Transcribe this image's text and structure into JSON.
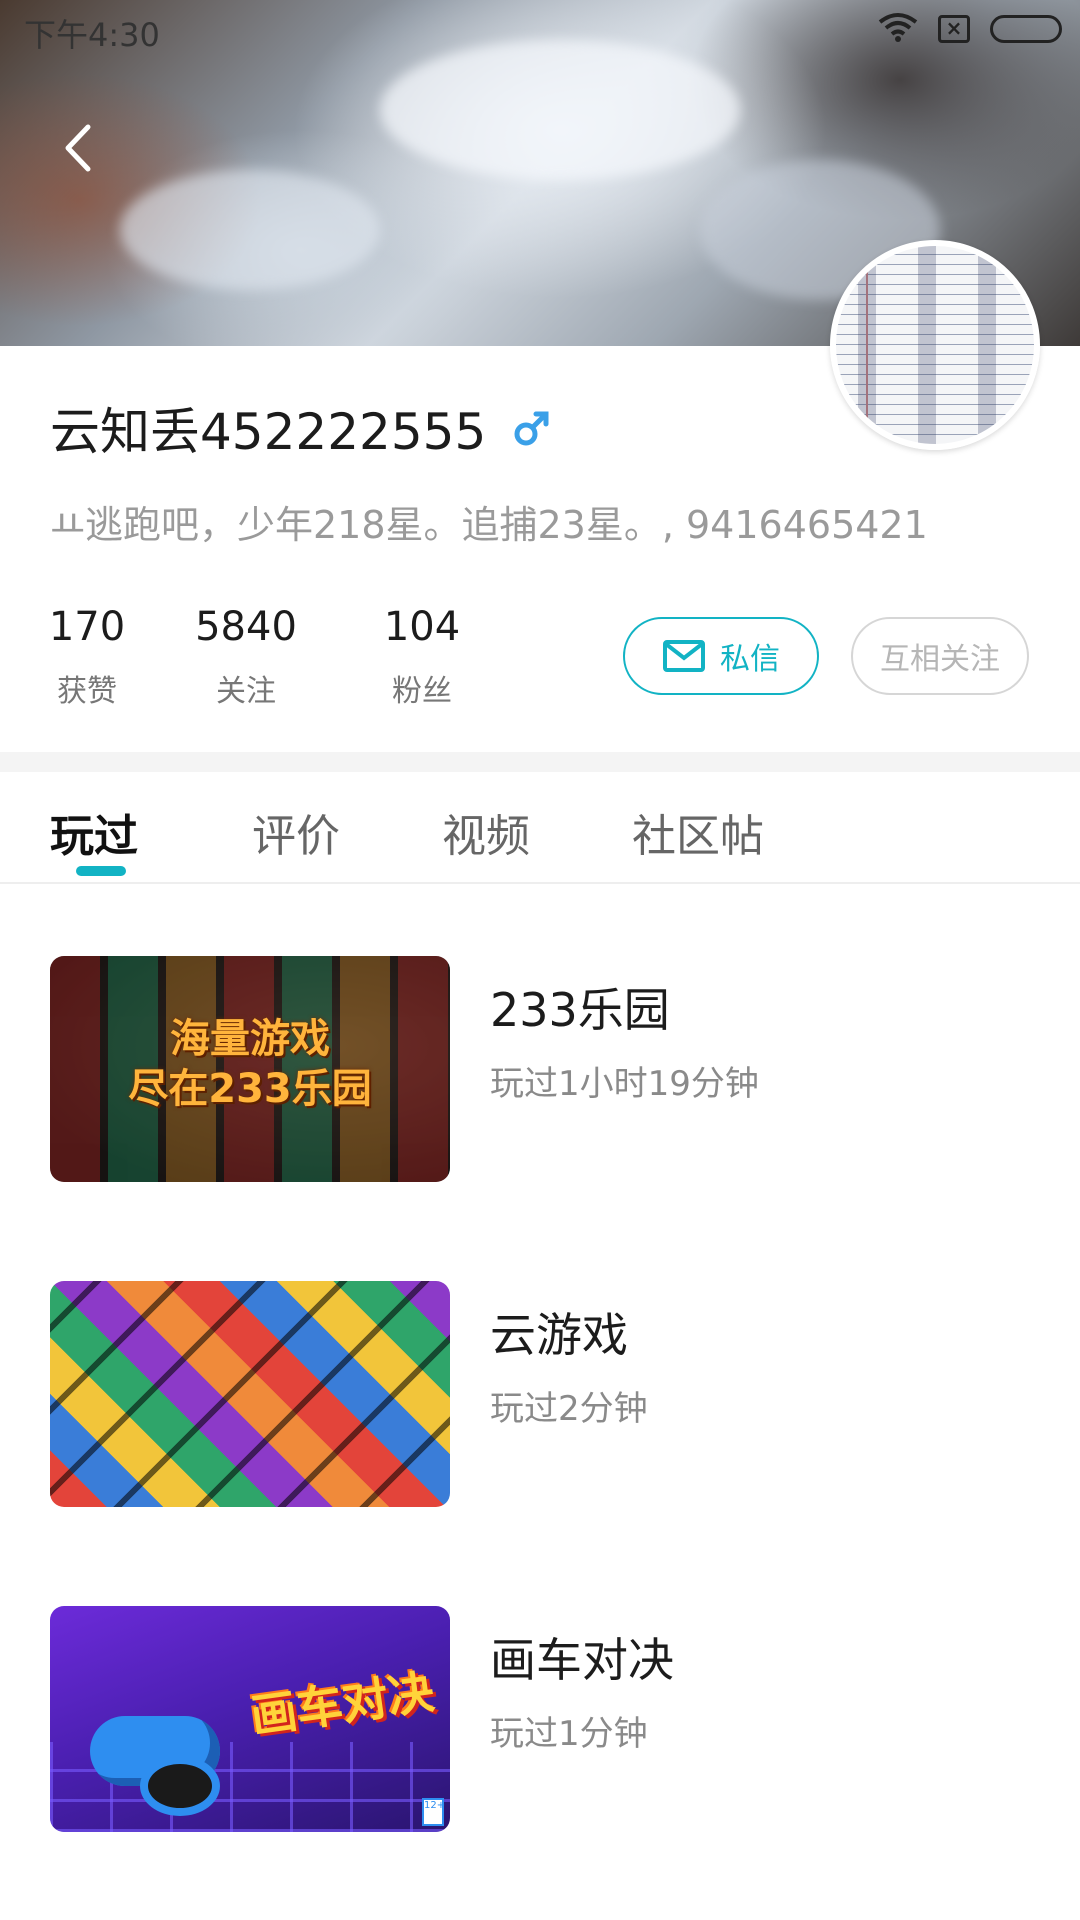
{
  "status_bar": {
    "time": "下午4:30"
  },
  "profile": {
    "username": "云知丢452222555",
    "signature": "ㅛ逃跑吧，少年218星。追捕23星。, 9416465421",
    "stats": [
      {
        "value": "170",
        "label": "获赞"
      },
      {
        "value": "5840",
        "label": "关注"
      },
      {
        "value": "104",
        "label": "粉丝"
      }
    ],
    "message_button": "私信",
    "follow_button": "互相关注"
  },
  "tabs": [
    {
      "label": "玩过",
      "active": true
    },
    {
      "label": "评价",
      "active": false
    },
    {
      "label": "视频",
      "active": false
    },
    {
      "label": "社区帖",
      "active": false
    }
  ],
  "games": [
    {
      "name": "233乐园",
      "played": "玩过1小时19分钟",
      "banner_line1": "海量游戏",
      "banner_line2": "尽在233乐园"
    },
    {
      "name": "云游戏",
      "played": "玩过2分钟"
    },
    {
      "name": "画车对决",
      "played": "玩过1分钟",
      "banner_logo": "画车对决",
      "age_rating": "12+"
    }
  ],
  "colors": {
    "accent": "#12b3c4",
    "muted_text": "#9a9a9a",
    "divider": "#f4f4f4"
  },
  "icons": {
    "back": "chevron-left-icon",
    "gender": "male-symbol-icon",
    "message": "envelope-icon",
    "wifi": "wifi-icon",
    "sim": "no-sim-icon",
    "battery": "battery-icon"
  }
}
